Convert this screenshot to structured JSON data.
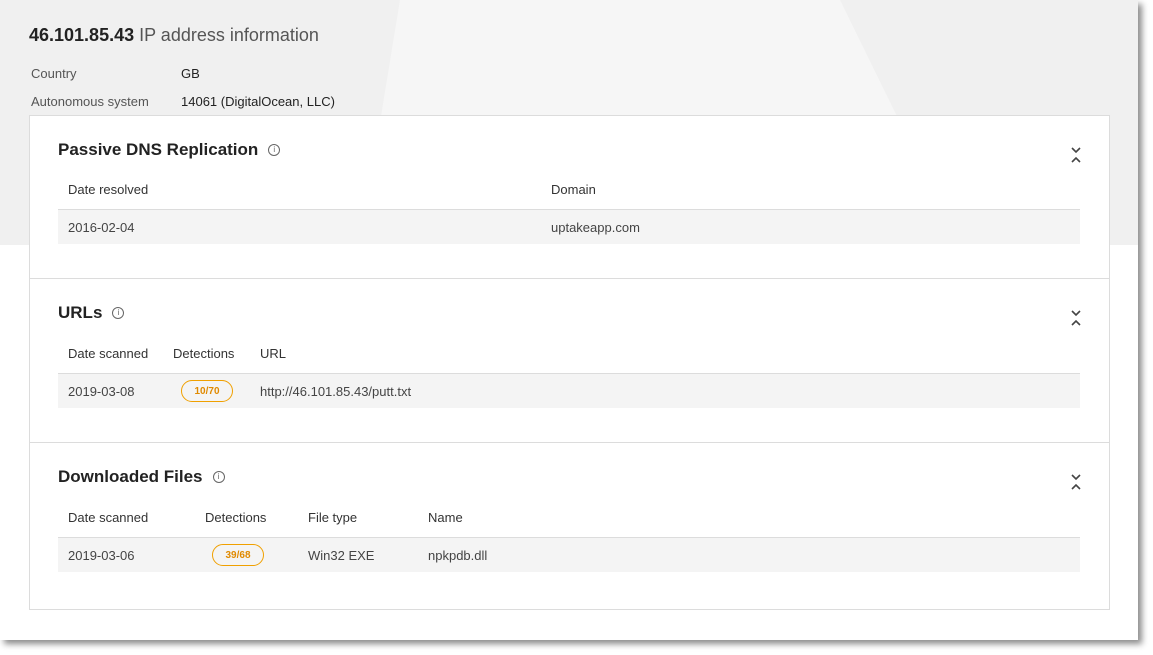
{
  "header": {
    "ip": "46.101.85.43",
    "title_suffix": "IP address information",
    "country_label": "Country",
    "country_value": "GB",
    "as_label": "Autonomous system",
    "as_value": "14061 (DigitalOcean, LLC)"
  },
  "passive_dns": {
    "title": "Passive DNS Replication",
    "columns": [
      "Date resolved",
      "Domain"
    ],
    "rows": [
      {
        "date": "2016-02-04",
        "domain": "uptakeapp.com"
      }
    ]
  },
  "urls": {
    "title": "URLs",
    "columns": [
      "Date scanned",
      "Detections",
      "URL"
    ],
    "rows": [
      {
        "date": "2019-03-08",
        "detections": "10/70",
        "url": "http://46.101.85.43/putt.txt"
      }
    ]
  },
  "downloaded_files": {
    "title": "Downloaded Files",
    "columns": [
      "Date scanned",
      "Detections",
      "File type",
      "Name"
    ],
    "rows": [
      {
        "date": "2019-03-06",
        "detections": "39/68",
        "file_type": "Win32 EXE",
        "name": "npkpdb.dll"
      }
    ]
  },
  "icons": {
    "info": "info-circle-icon",
    "collapse": "collapse-chevrons-icon"
  },
  "colors": {
    "hero_bg": "#f0f0f0",
    "badge_orange": "#f0a000",
    "row_bg": "#f4f4f4"
  }
}
